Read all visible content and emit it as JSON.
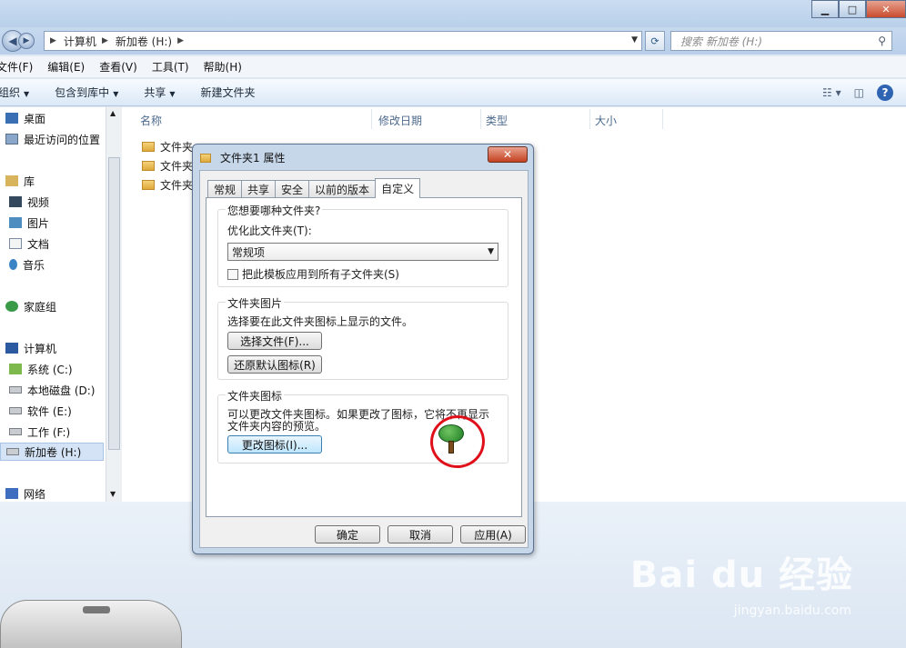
{
  "window": {
    "controls": {
      "minimize": "▁",
      "maximize": "□",
      "close": "✕"
    }
  },
  "address": {
    "path": [
      "计算机",
      "新加卷 (H:)"
    ],
    "search_placeholder": "搜索 新加卷 (H:)"
  },
  "menu": [
    "文件(F)",
    "编辑(E)",
    "查看(V)",
    "工具(T)",
    "帮助(H)"
  ],
  "toolbar": {
    "organize": "组织",
    "include_library": "包含到库中",
    "share": "共享",
    "new_folder": "新建文件夹"
  },
  "nav": {
    "favorites": [
      {
        "label": "桌面",
        "icon": "desktop-icon"
      },
      {
        "label": "最近访问的位置",
        "icon": "recent-places-icon"
      }
    ],
    "libraries_label": "库",
    "libraries": [
      {
        "label": "视频",
        "icon": "video-icon"
      },
      {
        "label": "图片",
        "icon": "pictures-icon"
      },
      {
        "label": "文档",
        "icon": "documents-icon"
      },
      {
        "label": "音乐",
        "icon": "music-icon"
      }
    ],
    "homegroup": "家庭组",
    "computer": "计算机",
    "drives": [
      {
        "label": "系统 (C:)",
        "icon": "system-drive-icon"
      },
      {
        "label": "本地磁盘 (D:)",
        "icon": "drive-icon"
      },
      {
        "label": "软件 (E:)",
        "icon": "drive-icon"
      },
      {
        "label": "工作 (F:)",
        "icon": "drive-icon"
      },
      {
        "label": "新加卷 (H:)",
        "icon": "drive-icon",
        "selected": true
      }
    ],
    "network": "网络"
  },
  "file_list": {
    "columns": [
      "名称",
      "修改日期",
      "类型",
      "大小"
    ],
    "rows": [
      "文件夹",
      "文件夹",
      "文件夹"
    ]
  },
  "dialog": {
    "title": "文件夹1 属性",
    "close": "✕",
    "tabs": [
      "常规",
      "共享",
      "安全",
      "以前的版本",
      "自定义"
    ],
    "active_tab": "自定义",
    "group1": {
      "title": "您想要哪种文件夹?",
      "optimize_label": "优化此文件夹(T):",
      "optimize_value": "常规项",
      "apply_subfolders": "把此模板应用到所有子文件夹(S)"
    },
    "group2": {
      "title": "文件夹图片",
      "desc": "选择要在此文件夹图标上显示的文件。",
      "choose_button": "选择文件(F)...",
      "restore_button": "还原默认图标(R)"
    },
    "group3": {
      "title": "文件夹图标",
      "desc_line1": "可以更改文件夹图标。如果更改了图标，它将不再显示",
      "desc_line2": "文件夹内容的预览。",
      "change_button": "更改图标(I)...",
      "icon": "tree-icon"
    },
    "buttons": {
      "ok": "确定",
      "cancel": "取消",
      "apply": "应用(A)"
    }
  },
  "watermark": {
    "main": "Bai du 经验",
    "sub": "jingyan.baidu.com"
  }
}
